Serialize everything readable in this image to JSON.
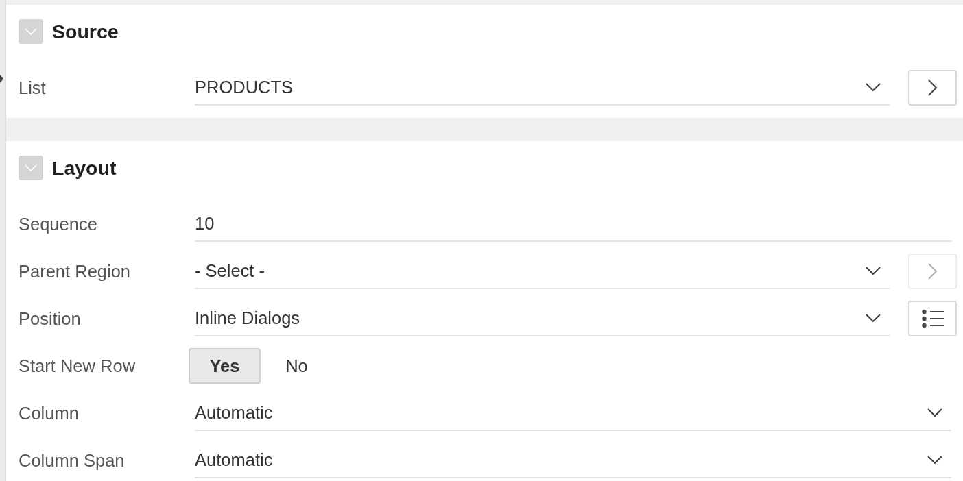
{
  "sections": [
    {
      "title": "Source",
      "expanded": true,
      "fields": [
        {
          "kind": "select",
          "label": "List",
          "value": "PRODUCTS",
          "button": {
            "kind": "go",
            "disabled": false
          }
        }
      ]
    },
    {
      "title": "Layout",
      "expanded": true,
      "fields": [
        {
          "kind": "text",
          "label": "Sequence",
          "value": "10"
        },
        {
          "kind": "select",
          "label": "Parent Region",
          "value": "- Select -",
          "button": {
            "kind": "go",
            "disabled": true
          }
        },
        {
          "kind": "select",
          "label": "Position",
          "value": "Inline Dialogs",
          "button": {
            "kind": "list",
            "disabled": false
          }
        },
        {
          "kind": "toggle",
          "label": "Start New Row",
          "options": [
            {
              "label": "Yes",
              "selected": true
            },
            {
              "label": "No",
              "selected": false
            }
          ]
        },
        {
          "kind": "select",
          "label": "Column",
          "value": "Automatic"
        },
        {
          "kind": "select",
          "label": "Column Span",
          "value": "Automatic"
        }
      ]
    }
  ]
}
